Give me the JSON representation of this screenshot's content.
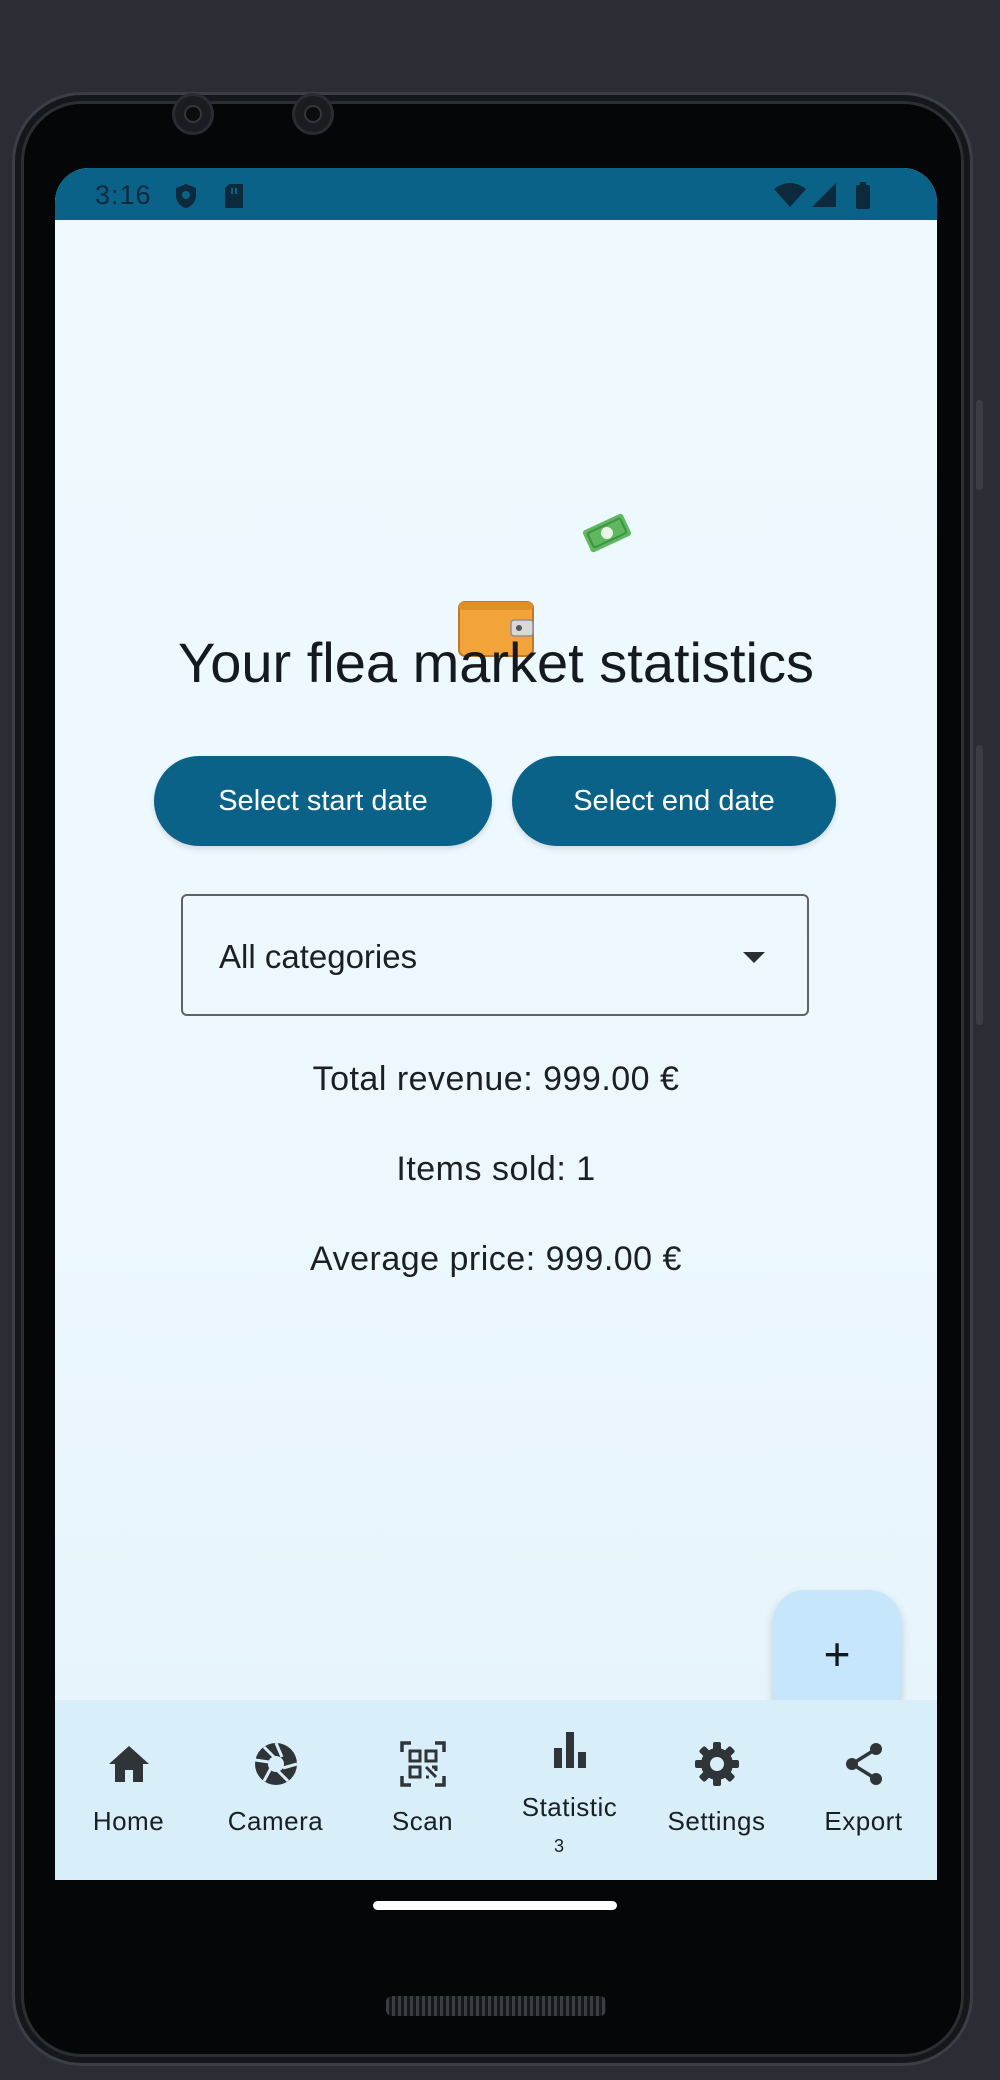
{
  "status_bar": {
    "time": "3:16"
  },
  "page": {
    "title": "Your flea market statistics"
  },
  "buttons": {
    "start_date": "Select start date",
    "end_date": "Select end date"
  },
  "category_select": {
    "selected": "All categories"
  },
  "stats": {
    "revenue": "Total revenue: 999.00 €",
    "items_sold": "Items sold: 1",
    "average_price": "Average price: 999.00 €"
  },
  "fab": {
    "label": "+"
  },
  "nav": {
    "items": [
      {
        "label": "Home",
        "icon": "home-icon"
      },
      {
        "label": "Camera",
        "icon": "camera-icon"
      },
      {
        "label": "Scan",
        "icon": "qr-scan-icon"
      },
      {
        "label": "Statistic",
        "sub": "3",
        "icon": "bar-chart-icon"
      },
      {
        "label": "Settings",
        "icon": "gear-icon"
      },
      {
        "label": "Export",
        "icon": "share-icon"
      }
    ]
  },
  "colors": {
    "primary": "#0a6289",
    "screen_bg": "#eefaff",
    "nav_bg": "#d8eef9",
    "fab_bg": "#c5e6fb"
  }
}
